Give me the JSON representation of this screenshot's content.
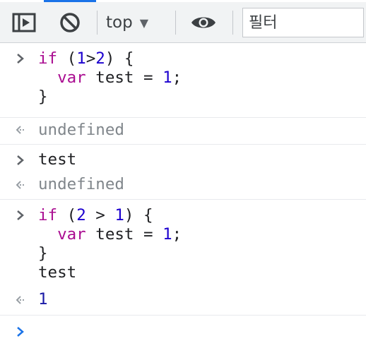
{
  "toolbar": {
    "context": "top",
    "filter_placeholder": "필터"
  },
  "icons": {
    "sidebar": "sidebar-toggle-icon",
    "clear": "clear-console-icon",
    "dropdown": "triangle-down-icon",
    "eye": "eye-icon",
    "prompt": "chevron-right-icon",
    "result": "return-arrow-icon"
  },
  "colors": {
    "keyword": "#aa0d91",
    "number": "#1c00cf",
    "result_number": "#1a1aa6",
    "muted": "#80868b",
    "prompt_active": "#1a73e8"
  },
  "console": {
    "e1": {
      "l1": {
        "a": "if",
        "b": " (",
        "c": "1",
        "d": ">",
        "e": "2",
        "f": ") {"
      },
      "l2": {
        "a": "  ",
        "b": "var",
        "c": " test = ",
        "d": "1",
        "e": ";"
      },
      "l3": "}"
    },
    "r1": "undefined",
    "e2": "test",
    "r2": "undefined",
    "e3": {
      "l1": {
        "a": "if",
        "b": " (",
        "c": "2",
        "d": " > ",
        "e": "1",
        "f": ") {"
      },
      "l2": {
        "a": "  ",
        "b": "var",
        "c": " test = ",
        "d": "1",
        "e": ";"
      },
      "l3": "}",
      "l4": "test"
    },
    "r3": "1"
  }
}
